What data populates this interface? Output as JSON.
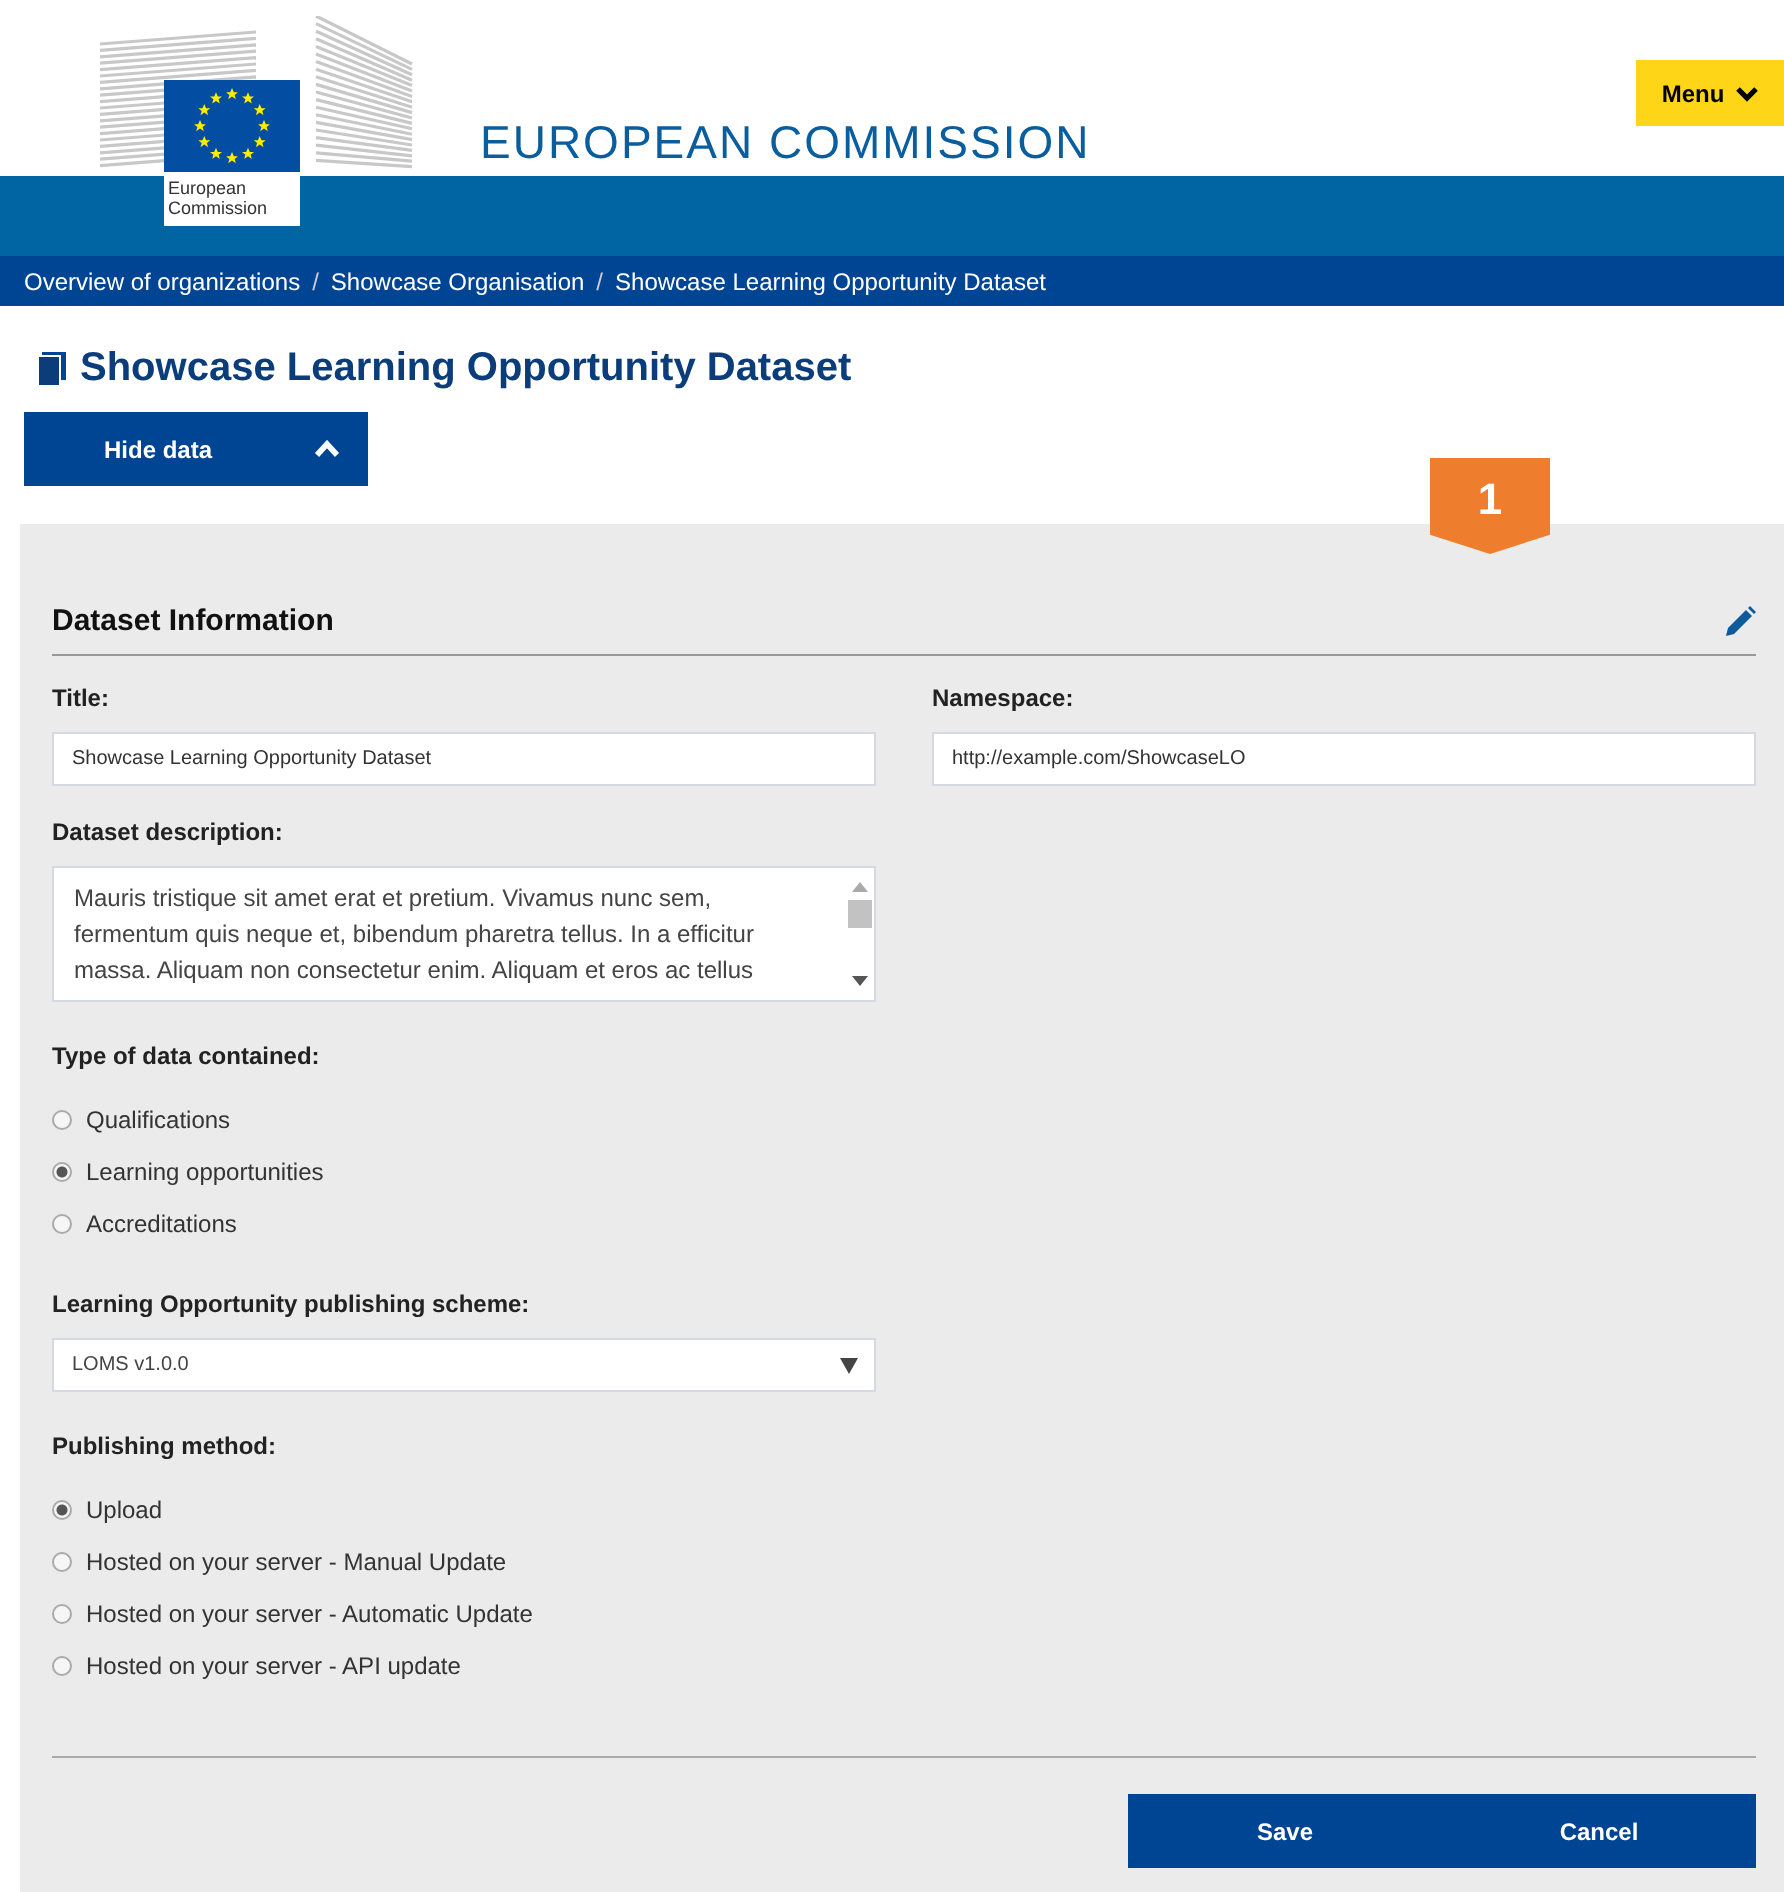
{
  "header": {
    "logo_text": "European Commission",
    "site_title": "EUROPEAN COMMISSION",
    "menu_button": "Menu"
  },
  "breadcrumb": [
    "Overview of organizations",
    "Showcase Organisation",
    "Showcase Learning Opportunity Dataset"
  ],
  "breadcrumb_separator": "/",
  "page_title": "Showcase Learning Opportunity Dataset",
  "toggle_button": {
    "label": "Hide data",
    "expanded": true
  },
  "step_badge": "1",
  "section": {
    "title": "Dataset Information",
    "title_field": {
      "label": "Title:",
      "value": "Showcase Learning Opportunity Dataset"
    },
    "namespace_field": {
      "label": "Namespace:",
      "value": "http://example.com/ShowcaseLO"
    },
    "description_field": {
      "label": "Dataset description:",
      "value": "Mauris tristique sit amet erat et pretium. Vivamus nunc sem, fermentum quis neque et, bibendum pharetra tellus. In a efficitur massa. Aliquam non consectetur enim. Aliquam et eros ac tellus"
    },
    "data_type": {
      "label": "Type of data contained:",
      "options": [
        {
          "label": "Qualifications",
          "selected": false
        },
        {
          "label": "Learning opportunities",
          "selected": true
        },
        {
          "label": "Accreditations",
          "selected": false
        }
      ]
    },
    "scheme_field": {
      "label": "Learning Opportunity publishing scheme:",
      "value": "LOMS v1.0.0"
    },
    "publishing_method": {
      "label": "Publishing method:",
      "options": [
        {
          "label": "Upload",
          "selected": true
        },
        {
          "label": "Hosted on your server - Manual Update",
          "selected": false
        },
        {
          "label": "Hosted on your server - Automatic Update",
          "selected": false
        },
        {
          "label": "Hosted on your server - API update",
          "selected": false
        }
      ]
    }
  },
  "buttons": [
    "Save",
    "Cancel"
  ]
}
